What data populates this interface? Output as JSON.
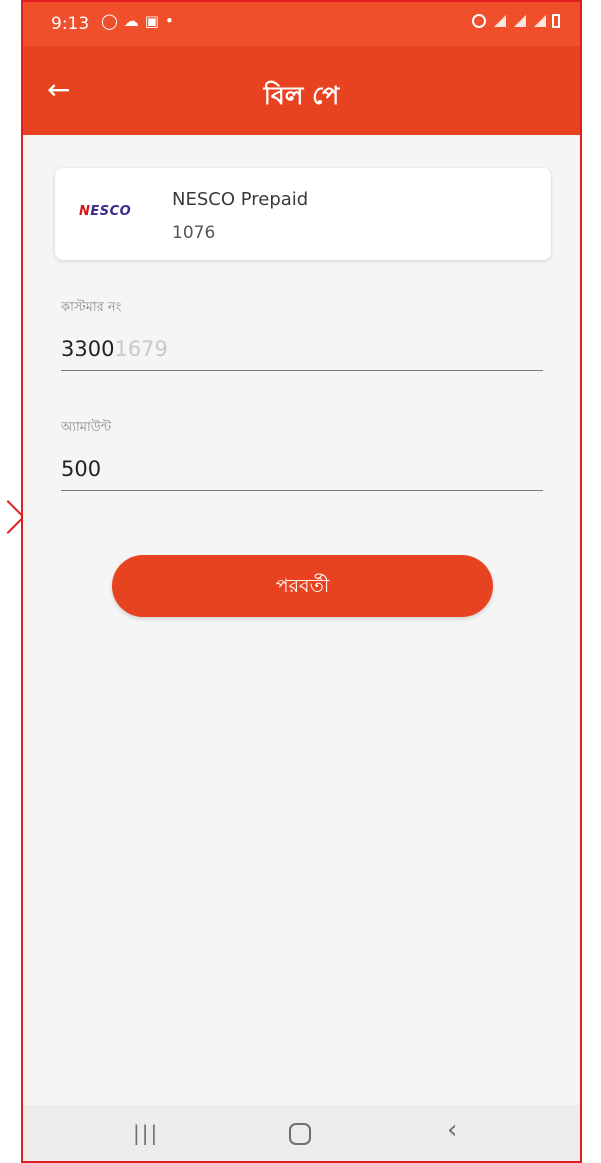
{
  "status_bar": {
    "time": "9:13"
  },
  "app_bar": {
    "title": "বিল পে",
    "back_icon": "arrow-left-icon"
  },
  "biller": {
    "logo_text": "NESCO",
    "name": "NESCO Prepaid",
    "code": "1076"
  },
  "fields": {
    "customer_no": {
      "label": "কাস্টমার নং",
      "value_visible": "3300",
      "value_faded": "1679"
    },
    "amount": {
      "label": "অ্যামাউন্ট",
      "value": "500"
    }
  },
  "actions": {
    "next_label": "পরবর্তী"
  },
  "colors": {
    "brand": "#e84321",
    "annotation": "#e02020"
  }
}
